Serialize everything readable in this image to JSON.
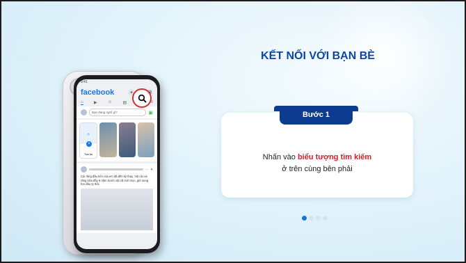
{
  "slide": {
    "title": "KẾT NỐI VỚI BẠN BÈ",
    "step_label": "Bước 1",
    "instruction_prefix": "Nhấn vào ",
    "instruction_highlight": "biểu tượng tìm kiếm",
    "instruction_line2": "ở trên cùng bên phải",
    "pager": {
      "total": 4,
      "active_index": 0
    }
  },
  "phone": {
    "status_time": "9:41",
    "app_logo": "facebook",
    "composer_placeholder": "Bạn đang nghĩ gì?",
    "create_story_label": "Tạo tin",
    "post_text": "Cái răng đầu tiên của em đã đến kỳ thay. Vận là cái răng sữa đầy 6 năm trước vật vã mới mọc, giờ sung hơi đầu tý thôi"
  },
  "colors": {
    "title": "#0d47a1",
    "badge": "#0d3b8f",
    "highlight": "#d0202a",
    "pager_active": "#1e73d8",
    "facebook_blue": "#1877f2"
  }
}
